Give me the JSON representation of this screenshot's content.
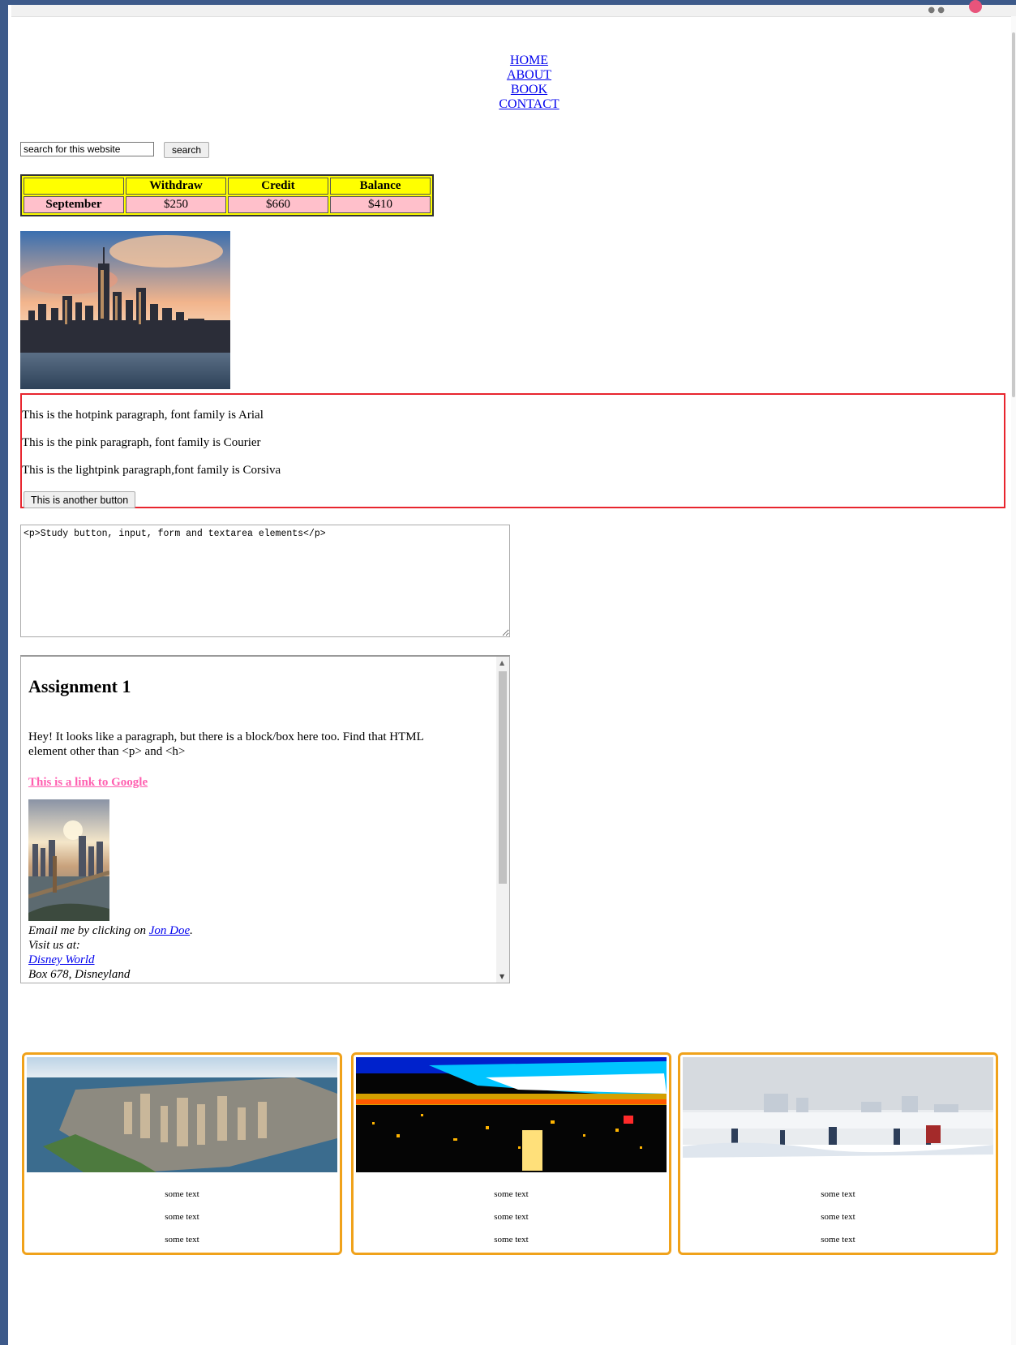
{
  "nav": {
    "items": [
      "HOME",
      "ABOUT",
      "BOOK",
      "CONTACT"
    ]
  },
  "search": {
    "value": "search for this website",
    "button_label": "search"
  },
  "bank_table": {
    "headers": [
      "",
      "Withdraw",
      "Credit",
      "Balance"
    ],
    "row": [
      "September",
      "$250",
      "$660",
      "$410"
    ]
  },
  "paragraphs": {
    "hotpink": "This is the hotpink paragraph, font family is Arial",
    "pink": "This is the pink paragraph, font family is Courier",
    "lightpink": "This is the lightpink paragraph,font family is Corsiva",
    "button_label": "This is another button"
  },
  "textarea": {
    "value": "<p>Study button, input, form and textarea elements</p>"
  },
  "assignment": {
    "title": "Assignment 1",
    "intro": "Hey! It looks like a paragraph, but there is a block/box here too. Find that HTML element other than <p> and <h>",
    "link_label": "This is a link to Google",
    "email_prefix": "Email me by clicking on ",
    "email_link": "Jon Doe",
    "email_suffix": ".",
    "visit_label": "Visit us at:",
    "place_link": "Disney World",
    "box_line": "Box 678, Disneyland"
  },
  "cards": [
    {
      "lines": [
        "some text",
        "some text",
        "some text"
      ]
    },
    {
      "lines": [
        "some text",
        "some text",
        "some text"
      ]
    },
    {
      "lines": [
        "some text",
        "some text",
        "some text"
      ]
    }
  ],
  "colors": {
    "table_header_bg": "#ffff00",
    "table_cell_bg": "#ffc0cb",
    "red_border": "#e8252e",
    "card_border": "#f0a21b",
    "link_hotpink": "#ff5fb0",
    "link_blue": "#0000ee"
  }
}
